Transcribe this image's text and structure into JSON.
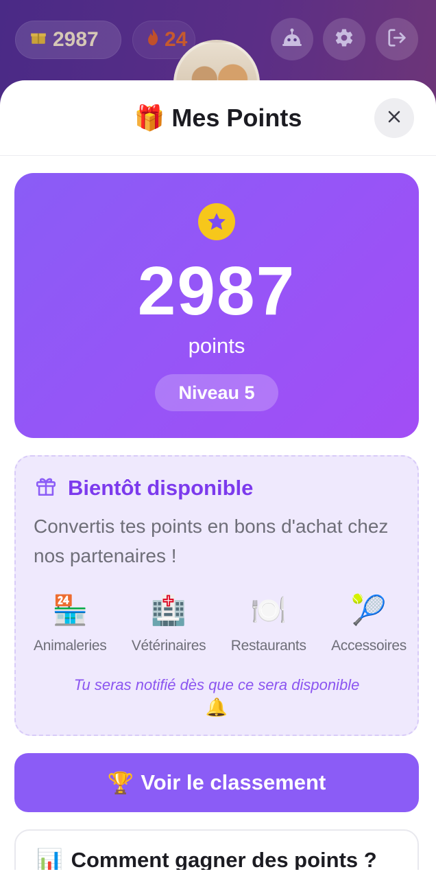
{
  "topbar": {
    "points_value": "2987",
    "streak_value": "24",
    "icons": [
      "gift-icon",
      "flame-icon",
      "robot-icon",
      "gear-icon",
      "logout-icon"
    ]
  },
  "sheet": {
    "title": "Mes Points",
    "title_emoji": "🎁"
  },
  "points_card": {
    "value": "2987",
    "unit": "points",
    "level": "Niveau 5"
  },
  "coming_soon": {
    "title": "Bientôt disponible",
    "description": "Convertis tes points en bons d'achat chez nos partenaires !",
    "partners": [
      {
        "icon": "🏪",
        "label": "Animaleries"
      },
      {
        "icon": "🏥",
        "label": "Vétérinaires"
      },
      {
        "icon": "🍽️",
        "label": "Restaurants"
      },
      {
        "icon": "🎾",
        "label": "Accessoires"
      }
    ],
    "notify_text": "Tu seras notifié dès que ce sera disponible",
    "notify_emoji": "🔔"
  },
  "ranking_button": {
    "emoji": "🏆",
    "label": "Voir le classement"
  },
  "earn_card": {
    "emoji": "📊",
    "title": "Comment gagner des points ?"
  },
  "colors": {
    "accent": "#8b5cf6",
    "accent_dark": "#7c3aed",
    "star": "#f6c71b",
    "soon_bg": "#efe9fd"
  }
}
